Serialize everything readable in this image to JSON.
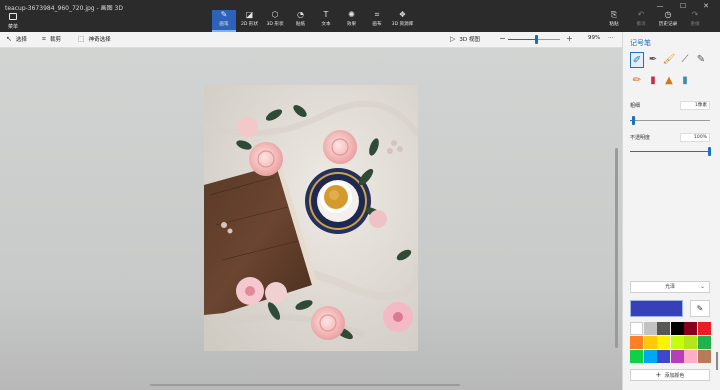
{
  "window": {
    "title": "teacup-3673984_960_720.jpg - 画图 3D",
    "controls": [
      "—",
      "☐",
      "✕"
    ]
  },
  "menu": {
    "label": "菜单"
  },
  "tools": [
    {
      "label": "画笔",
      "icon": "brush-icon",
      "glyph": "✎",
      "active": true
    },
    {
      "label": "2D 形状",
      "icon": "2d-shapes-icon",
      "glyph": "◪",
      "active": false
    },
    {
      "label": "3D 形状",
      "icon": "3d-shapes-icon",
      "glyph": "⬡",
      "active": false
    },
    {
      "label": "贴纸",
      "icon": "stickers-icon",
      "glyph": "◔",
      "active": false
    },
    {
      "label": "文本",
      "icon": "text-icon",
      "glyph": "T",
      "active": false
    },
    {
      "label": "效果",
      "icon": "effects-icon",
      "glyph": "✺",
      "active": false
    },
    {
      "label": "画布",
      "icon": "canvas-icon",
      "glyph": "⌗",
      "active": false
    },
    {
      "label": "3D 资源库",
      "icon": "3d-library-icon",
      "glyph": "❖",
      "active": false
    }
  ],
  "right_tools": [
    {
      "label": "粘贴",
      "icon": "paste-icon",
      "glyph": "⎘",
      "dim": false
    },
    {
      "label": "撤消",
      "icon": "undo-icon",
      "glyph": "↶",
      "dim": true
    },
    {
      "label": "历史记录",
      "icon": "history-icon",
      "glyph": "◷",
      "dim": false
    },
    {
      "label": "重做",
      "icon": "redo-icon",
      "glyph": "↷",
      "dim": true
    }
  ],
  "subbar": {
    "select": "选择",
    "crop": "裁剪",
    "magic_select": "神奇选择",
    "view3d": "3D 视图",
    "zoom_percent": "99%",
    "zoom_level": 0.55,
    "more": "···"
  },
  "panel": {
    "title": "记号笔",
    "brushes": [
      {
        "name": "marker",
        "glyph": "✐",
        "color": "#1f6fc4"
      },
      {
        "name": "calligraphy-pen",
        "glyph": "✒",
        "color": "#555555"
      },
      {
        "name": "oil-brush",
        "glyph": "🖌",
        "color": "#c58a2a"
      },
      {
        "name": "watercolor",
        "glyph": "⟋",
        "color": "#555555"
      },
      {
        "name": "pixel-pen",
        "glyph": "✎",
        "color": "#555555"
      },
      {
        "name": "pencil",
        "glyph": "✏",
        "color": "#d45b2a"
      },
      {
        "name": "eraser",
        "glyph": "▮",
        "color": "#c92f4a"
      },
      {
        "name": "crayon",
        "glyph": "▲",
        "color": "#d8751a"
      },
      {
        "name": "spray-can",
        "glyph": "▮",
        "color": "#3a8fae"
      }
    ],
    "thickness_label": "粗细",
    "thickness_value": "1像素",
    "thickness_level": 0.05,
    "opacity_label": "不透明度",
    "opacity_value": "100%",
    "opacity_level": 1.0,
    "finish_label": "光泽",
    "current_color": "#3640b8",
    "add_color_label": "添加颜色",
    "palette": [
      "#ffffff",
      "#c3c3c3",
      "#585858",
      "#000000",
      "#88001b",
      "#ec1c24",
      "#ff7f27",
      "#ffc90e",
      "#fff200",
      "#c4ff0e",
      "#b5e61d",
      "#22b14c",
      "#0ed145",
      "#00a8f3",
      "#3f48cc",
      "#b83dba",
      "#ffaec8",
      "#b97a57"
    ]
  }
}
